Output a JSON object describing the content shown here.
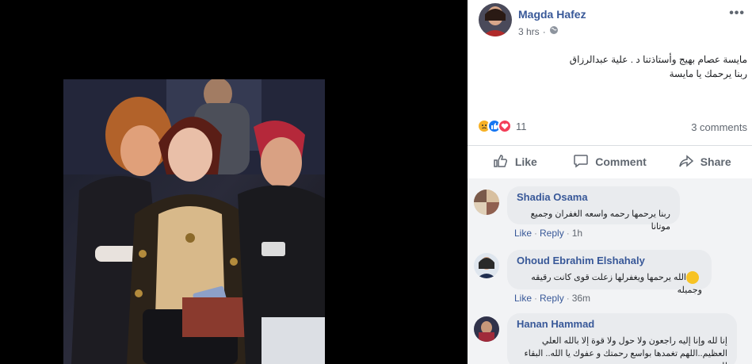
{
  "post": {
    "author": "Magda Hafez",
    "time": "3 hrs",
    "text_line1": "مايسة عصام بهيج وأستاذتنا د . علية عبدالرزاق",
    "text_line2": "ربنا يرحمك يا مايسة",
    "reaction_count": "11",
    "comments_count": "3 comments"
  },
  "actions": {
    "like": "Like",
    "comment": "Comment",
    "share": "Share"
  },
  "comments": [
    {
      "name": "Shadia Osama",
      "text": "ربنا يرحمها رحمه واسعه الغفران وجميع موتانا",
      "like": "Like",
      "reply": "Reply",
      "time": "1h"
    },
    {
      "name": "Ohoud Ebrahim Elshahaly",
      "text": "الله يرحمها ويغفرلها زعلت قوى كانت رقيقه وجميله",
      "like": "Like",
      "reply": "Reply",
      "time": "36m"
    },
    {
      "name": "Hanan Hammad",
      "text_line1": "إنا لله وإنا إليه راجعون ولا حول ولا قوة إلا بالله العلي",
      "text_line2": "العظيم..اللهم تغمدها بواسع رحمتك و عفوك يا الله.. البقاء لله",
      "like": "",
      "reply": "",
      "time": ""
    }
  ],
  "icons": {
    "globe": "globe-icon",
    "more": "more-options-icon",
    "like": "thumbs-up-icon",
    "comment": "comment-bubble-icon",
    "share": "share-arrow-icon"
  },
  "colors": {
    "link": "#385898",
    "muted": "#606770",
    "like_blue": "#1877f2",
    "love_red": "#f33e58",
    "sad_yellow": "#f7b125"
  }
}
